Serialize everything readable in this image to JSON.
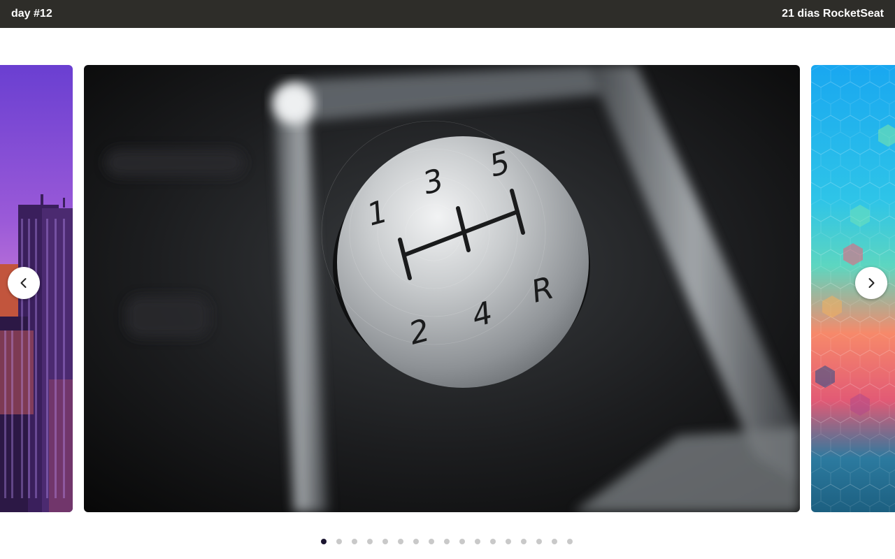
{
  "header": {
    "title": "day #12",
    "brand": "21 dias RocketSeat"
  },
  "carousel": {
    "slides": [
      {
        "name": "city-skyline-image"
      },
      {
        "name": "gear-shift-knob-image",
        "knob_markings": [
          "1",
          "3",
          "5",
          "2",
          "4",
          "R"
        ]
      },
      {
        "name": "hexagon-pattern-image"
      }
    ],
    "prev_icon": "chevron-left-icon",
    "next_icon": "chevron-right-icon",
    "dot_count": 17,
    "active_index": 0
  },
  "colors": {
    "topbar_bg": "#2e2d29",
    "topbar_text": "#ffffff",
    "dot_active": "#1b1530",
    "dot_inactive": "#c9c9c9"
  }
}
